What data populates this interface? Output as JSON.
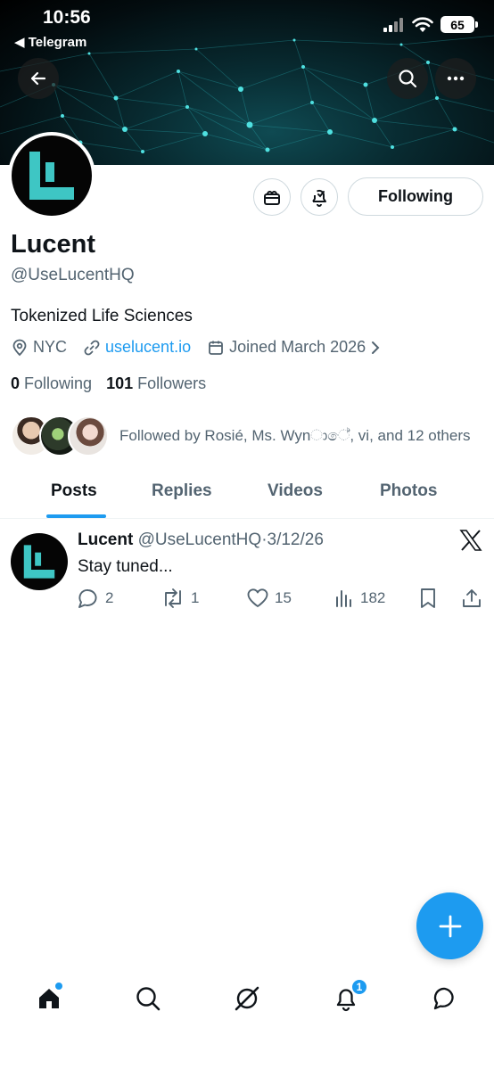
{
  "status_bar": {
    "time": "10:56",
    "back_app": "◀ Telegram",
    "battery": "65"
  },
  "profile": {
    "name": "Lucent",
    "handle": "@UseLucentHQ",
    "bio": "Tokenized Life Sciences",
    "location": "NYC",
    "website": "uselucent.io",
    "joined": "Joined March 2026",
    "following_count": "0",
    "following_label": "Following",
    "followers_count": "101",
    "followers_label": "Followers",
    "followed_by": "Followed by Rosié, Ms. Wynාේ, vi, and 12 others",
    "follow_button": "Following"
  },
  "tabs": [
    {
      "label": "Posts",
      "active": true
    },
    {
      "label": "Replies",
      "active": false
    },
    {
      "label": "Videos",
      "active": false
    },
    {
      "label": "Photos",
      "active": false
    }
  ],
  "post": {
    "author": "Lucent",
    "handle": "@UseLucentHQ",
    "separator": "·",
    "date": "3/12/26",
    "text": "Stay tuned...",
    "replies": "2",
    "reposts": "1",
    "likes": "15",
    "views": "182"
  },
  "nav": {
    "notifications_badge": "1"
  },
  "colors": {
    "accent": "#1d9bf0",
    "brand_teal": "#3ec6c4",
    "secondary_text": "#536471"
  }
}
